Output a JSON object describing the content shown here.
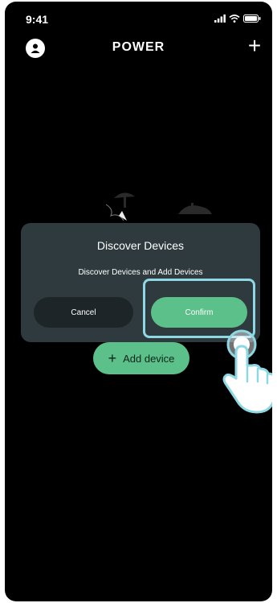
{
  "status_bar": {
    "time": "9:41"
  },
  "header": {
    "title": "POWER"
  },
  "dialog": {
    "title": "Discover Devices",
    "message": "Discover Devices and Add Devices",
    "cancel_label": "Cancel",
    "confirm_label": "Confirm"
  },
  "main": {
    "add_device_label": "Add device"
  },
  "colors": {
    "accent": "#5cc08a",
    "dialog_bg": "#2f3a3e",
    "highlight": "#8ed8e4",
    "background": "#000000"
  }
}
